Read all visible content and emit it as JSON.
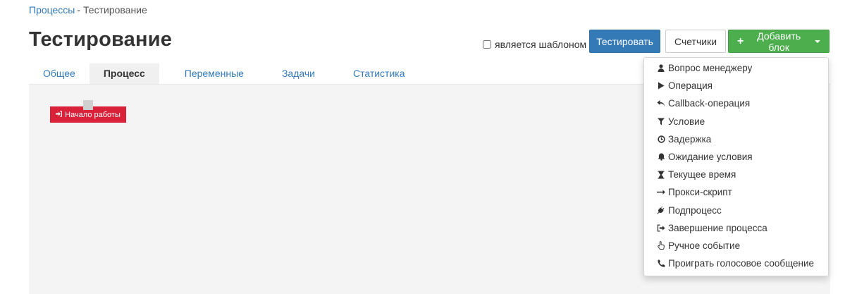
{
  "breadcrumb": {
    "parent": "Процессы",
    "separator": "-",
    "current": "Тестирование"
  },
  "page": {
    "title": "Тестирование"
  },
  "toolbar": {
    "template_checkbox_label": "является шаблоном",
    "test_label": "Тестировать",
    "counters_label": "Счетчики",
    "add_block_label": "Добавить блок",
    "accent_blue": "#337ab7",
    "accent_green": "#4cae4c"
  },
  "tabs": [
    {
      "label": "Общее",
      "active": false
    },
    {
      "label": "Процесс",
      "active": true
    },
    {
      "label": "Переменные",
      "active": false
    },
    {
      "label": "Задачи",
      "active": false
    },
    {
      "label": "Статистика",
      "active": false
    }
  ],
  "canvas": {
    "start_node": {
      "label": "Начало работы",
      "icon": "sign-in-icon",
      "color": "#d9213a"
    }
  },
  "add_block_menu": {
    "items": [
      {
        "label": "Вопрос менеджеру",
        "icon": "user-icon"
      },
      {
        "label": "Операция",
        "icon": "play-icon"
      },
      {
        "label": "Callback-операция",
        "icon": "reply-icon"
      },
      {
        "label": "Условие",
        "icon": "filter-icon"
      },
      {
        "label": "Задержка",
        "icon": "clock-icon"
      },
      {
        "label": "Ожидание условия",
        "icon": "bell-icon"
      },
      {
        "label": "Текущее время",
        "icon": "hourglass-icon"
      },
      {
        "label": "Прокси-скрипт",
        "icon": "arrow-right-icon"
      },
      {
        "label": "Подпроцесс",
        "icon": "plug-icon"
      },
      {
        "label": "Завершение процесса",
        "icon": "sign-out-icon"
      },
      {
        "label": "Ручное событие",
        "icon": "hand-pointer-icon"
      },
      {
        "label": "Проиграть голосовое сообщение",
        "icon": "phone-icon"
      }
    ]
  }
}
